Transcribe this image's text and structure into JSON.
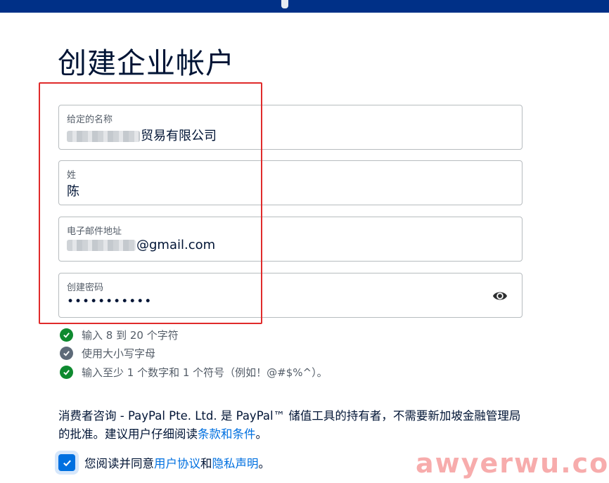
{
  "page": {
    "title": "创建企业帐户"
  },
  "form": {
    "given_name": {
      "label": "给定的名称",
      "value_partial": "贸易有限公司"
    },
    "surname": {
      "label": "姓",
      "value": "陈"
    },
    "email": {
      "label": "电子邮件地址",
      "value_partial": "@gmail.com"
    },
    "password": {
      "label": "创建密码",
      "value_masked": "•••••••••••",
      "toggle_icon": "eye-icon"
    }
  },
  "password_rules": [
    {
      "text": "输入 8 到 20 个字符",
      "status": "met",
      "icon": "check-circle-icon"
    },
    {
      "text": "使用大小写字母",
      "status": "unmet",
      "icon": "check-circle-icon"
    },
    {
      "text": "输入至少 1 个数字和 1 个符号（例如！@#$%^）。",
      "status": "met",
      "icon": "check-circle-icon"
    }
  ],
  "consumer_notice": {
    "text": "消费者咨询 - PayPal Pte. Ltd. 是 PayPal™ 储值工具的持有者，不需要新加坡金融管理局的批准。建议用户仔细阅读",
    "link": "条款和条件",
    "suffix": "。"
  },
  "agreement": {
    "checked": true,
    "prefix": "您阅读并同意",
    "link1": "用户协议",
    "middle": "和",
    "link2": "隐私声明",
    "suffix": "。"
  },
  "watermark": "awyerwu.com",
  "colors": {
    "header": "#003087",
    "link": "#0070e0",
    "success": "#0e8a2f",
    "pending": "#5d6a78",
    "highlight_box": "#e02b2b"
  }
}
